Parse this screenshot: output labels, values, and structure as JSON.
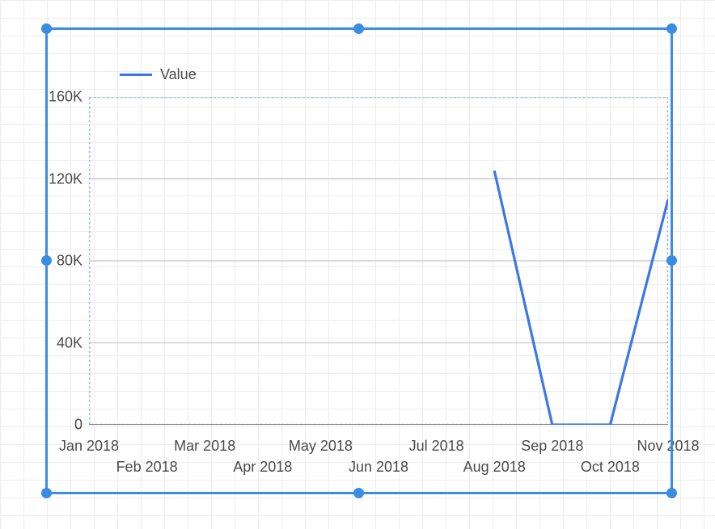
{
  "chart_data": {
    "type": "line",
    "x": [
      "Jan 2018",
      "Feb 2018",
      "Mar 2018",
      "Apr 2018",
      "May 2018",
      "Jun 2018",
      "Jul 2018",
      "Aug 2018",
      "Sep 2018",
      "Oct 2018",
      "Nov 2018"
    ],
    "series": [
      {
        "name": "Value",
        "color": "#3b78e7",
        "values": [
          null,
          null,
          null,
          null,
          null,
          null,
          null,
          124000,
          0,
          0,
          110000
        ]
      }
    ],
    "ylabel": "",
    "xlabel": "",
    "title": "",
    "ylim": [
      0,
      160000
    ],
    "y_ticks": [
      0,
      40000,
      80000,
      120000,
      160000
    ],
    "y_tick_labels": [
      "0",
      "40K",
      "80K",
      "120K",
      "160K"
    ],
    "selection_color": "#3b8de3",
    "inner_selection_color": "#8db6e8",
    "legend_position": "top-left"
  }
}
